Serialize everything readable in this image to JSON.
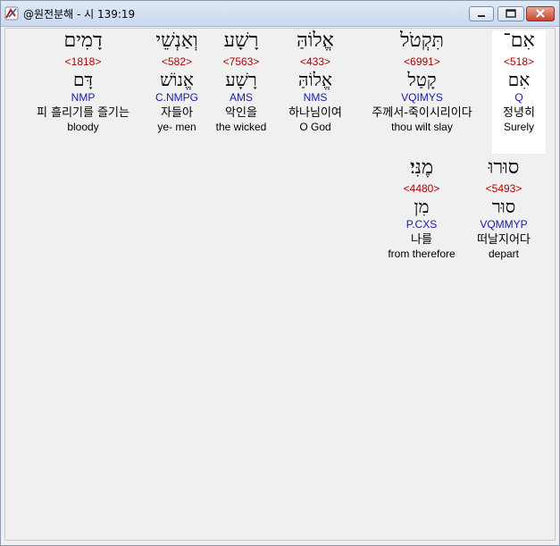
{
  "window": {
    "title": "@원전분해 - 시 139:19"
  },
  "rows": [
    [
      {
        "heb": "אִם־",
        "num": "<518>",
        "lemma": "אִם",
        "code": "Q",
        "kor": "정녕히",
        "eng": "Surely"
      },
      {
        "heb": "תִּקְטֹל",
        "num": "<6991>",
        "lemma": "קָטַל",
        "code": "VQIMYS",
        "kor": "주께서-죽이시리이다",
        "eng": "thou wilt slay"
      },
      {
        "heb": "אֱלוֹהַּ",
        "num": "<433>",
        "lemma": "אֱלוֹהַּ",
        "code": "NMS",
        "kor": "하나님이여",
        "eng": "O God"
      },
      {
        "heb": "רָשָׁע",
        "num": "<7563>",
        "lemma": "רָשָׁע",
        "code": "AMS",
        "kor": "악인을",
        "eng": "the wicked"
      },
      {
        "heb": "וְאַנְשֵׁי",
        "num": "<582>",
        "lemma": "אֱנוֹשׁ",
        "code": "C.NMPG",
        "kor": "자들아",
        "eng": "ye- men"
      },
      {
        "heb": "דָמִים",
        "num": "<1818>",
        "lemma": "דָּם",
        "code": "NMP",
        "kor": "피 흘리기를 즐기는",
        "eng": "bloody"
      }
    ],
    [
      {
        "heb": "סוּרוּ",
        "num": "<5493>",
        "lemma": "סוּר",
        "code": "VQMMYP",
        "kor": "떠날지어다",
        "eng": "depart"
      },
      {
        "heb": "מֶנִּי׃",
        "num": "<4480>",
        "lemma": "מִן",
        "code": "P.CXS",
        "kor": "나를",
        "eng": "from therefore"
      }
    ]
  ]
}
